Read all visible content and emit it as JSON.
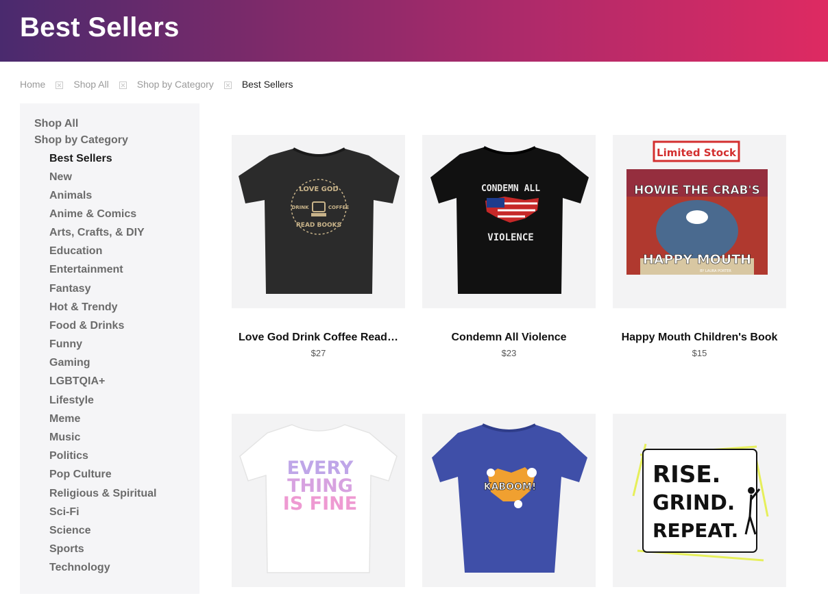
{
  "banner": {
    "title": "Best Sellers"
  },
  "breadcrumb": [
    {
      "label": "Home"
    },
    {
      "label": "Shop All"
    },
    {
      "label": "Shop by Category"
    },
    {
      "label": "Best Sellers"
    }
  ],
  "sidebar": {
    "shop_all": "Shop All",
    "shop_by_category": "Shop by Category",
    "categories": [
      "Best Sellers",
      "New",
      "Animals",
      "Anime & Comics",
      "Arts, Crafts, & DIY",
      "Education",
      "Entertainment",
      "Fantasy",
      "Hot & Trendy",
      "Food & Drinks",
      "Funny",
      "Gaming",
      "LGBTQIA+",
      "Lifestyle",
      "Meme",
      "Music",
      "Politics",
      "Pop Culture",
      "Religious & Spiritual",
      "Sci-Fi",
      "Science",
      "Sports",
      "Technology"
    ]
  },
  "products": [
    {
      "name": "Love God Drink Coffee Read…",
      "price": "$27",
      "image_icon": "tshirt-icon",
      "art": {
        "line1": "LOVE GOD",
        "left": "DRINK",
        "right": "COFFEE",
        "line2": "READ BOOKS"
      }
    },
    {
      "name": "Condemn All Violence",
      "price": "$23",
      "image_icon": "tshirt-icon",
      "art": {
        "line1": "CONDEMN ALL",
        "line2": "VIOLENCE"
      }
    },
    {
      "name": "Happy Mouth Children's Book",
      "price": "$15",
      "image_icon": "book-icon",
      "art": {
        "badge": "Limited Stock",
        "line1": "HOWIE THE CRAB'S",
        "line2": "HAPPY MOUTH",
        "credit": "BY LAURA PORTER"
      }
    },
    {
      "name": "",
      "price": "",
      "image_icon": "tshirt-icon",
      "art": {
        "line1": "EVERY",
        "line2": "THING",
        "line3": "IS FINE"
      }
    },
    {
      "name": "",
      "price": "",
      "image_icon": "tshirt-icon",
      "art": {
        "line1": "KABOOM!"
      }
    },
    {
      "name": "",
      "price": "",
      "image_icon": "sticker-icon",
      "art": {
        "line1": "RISE.",
        "line2": "GRIND.",
        "line3": "REPEAT."
      }
    }
  ]
}
